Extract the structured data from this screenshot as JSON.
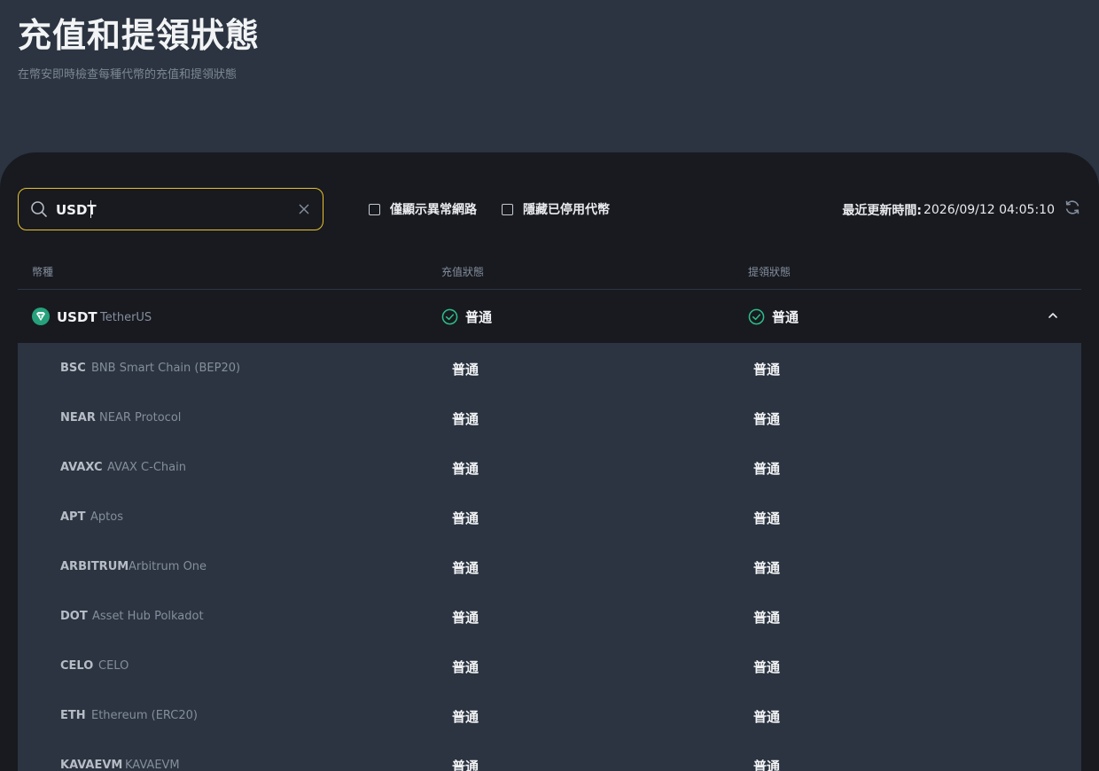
{
  "header": {
    "title": "充值和提領狀態",
    "subtitle": "在幣安即時檢查每種代幣的充值和提領狀態"
  },
  "toolbar": {
    "search_value": "USDT",
    "filter_abnormal_label": "僅顯示異常網路",
    "filter_hide_label": "隱藏已停用代幣",
    "update_label": "最近更新時間:",
    "update_time": "2026/09/12 04:05:10"
  },
  "table": {
    "headers": {
      "coin": "幣種",
      "deposit": "充值狀態",
      "withdraw": "提領狀態"
    },
    "coin": {
      "symbol": "USDT",
      "name": "TetherUS",
      "deposit_status": "普通",
      "withdraw_status": "普通",
      "expanded": true
    },
    "networks": [
      {
        "symbol": "BSC",
        "name": "BNB Smart Chain (BEP20)",
        "deposit": "普通",
        "withdraw": "普通"
      },
      {
        "symbol": "NEAR",
        "name": "NEAR Protocol",
        "deposit": "普通",
        "withdraw": "普通"
      },
      {
        "symbol": "AVAXC",
        "name": "AVAX C-Chain",
        "deposit": "普通",
        "withdraw": "普通"
      },
      {
        "symbol": "APT",
        "name": "Aptos",
        "deposit": "普通",
        "withdraw": "普通"
      },
      {
        "symbol": "ARBITRUM",
        "name": "Arbitrum One",
        "deposit": "普通",
        "withdraw": "普通"
      },
      {
        "symbol": "DOT",
        "name": "Asset Hub Polkadot",
        "deposit": "普通",
        "withdraw": "普通"
      },
      {
        "symbol": "CELO",
        "name": "CELO",
        "deposit": "普通",
        "withdraw": "普通"
      },
      {
        "symbol": "ETH",
        "name": "Ethereum (ERC20)",
        "deposit": "普通",
        "withdraw": "普通"
      },
      {
        "symbol": "KAVAEVM",
        "name": "KAVAEVM",
        "deposit": "普通",
        "withdraw": "普通"
      }
    ]
  },
  "colors": {
    "accent": "#e6c22b",
    "status_ok": "#2ebd85",
    "coin_icon": "#26a17b"
  }
}
